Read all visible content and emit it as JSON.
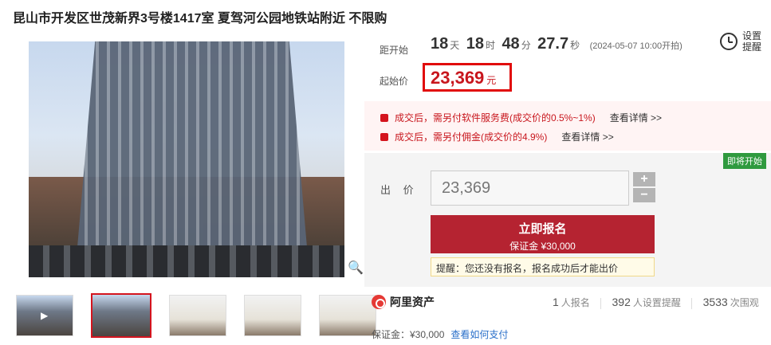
{
  "title": "昆山市开发区世茂新界3号楼1417室 夏驾河公园地铁站附近 不限购",
  "countdown": {
    "label": "距开始",
    "days": "18",
    "days_unit": "天",
    "hours": "18",
    "hours_unit": "时",
    "minutes": "48",
    "minutes_unit": "分",
    "seconds": "27.7",
    "seconds_unit": "秒",
    "start_time": "(2024-05-07 10:00开拍)"
  },
  "reminder": {
    "label": "设置提醒",
    "icon": "alarm-clock-icon"
  },
  "starting_price": {
    "label": "起始价",
    "value": "23,369",
    "unit": "元"
  },
  "fees": [
    {
      "text": "成交后，需另付软件服务费(成交价的0.5%~1%)",
      "link": "查看详情 >>"
    },
    {
      "text": "成交后，需另付佣金(成交价的4.9%)",
      "link": "查看详情 >>"
    }
  ],
  "bid": {
    "badge": "即将开始",
    "label": "出 价",
    "value": "23,369",
    "plus": "+",
    "minus": "−",
    "signup_label": "立即报名",
    "signup_deposit": "保证金 ¥30,000",
    "tip": "提醒：您还没有报名，报名成功后才能出价"
  },
  "platform": {
    "name": "阿里资产",
    "icon": "alibaba-assets-icon"
  },
  "stats": [
    {
      "value": "1",
      "label": "人报名"
    },
    {
      "value": "392",
      "label": "人设置提醒"
    },
    {
      "value": "3533",
      "label": "次围观"
    }
  ],
  "deposit": {
    "text": "保证金：¥30,000",
    "link": "查看如何支付"
  },
  "colors": {
    "accent": "#b52331",
    "price": "#c8161d",
    "badge": "#2f9a3f"
  }
}
